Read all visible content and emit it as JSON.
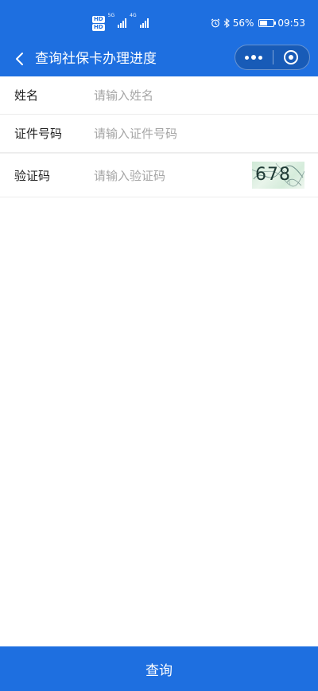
{
  "status_bar": {
    "hd_top": "HD",
    "hd_bottom": "HD",
    "network_1": "5G",
    "network_2": "4G",
    "battery_percent": "56%",
    "battery_level": 0.56,
    "time": "09:53",
    "icons": [
      "alarm-icon",
      "bluetooth-icon",
      "battery-icon"
    ]
  },
  "nav": {
    "title": "查询社保卡办理进度",
    "back_icon": "chevron-left-icon",
    "more_icon": "more-dots-icon",
    "close_icon": "target-circle-icon"
  },
  "form": {
    "name": {
      "label": "姓名",
      "placeholder": "请输入姓名",
      "value": ""
    },
    "id_number": {
      "label": "证件号码",
      "placeholder": "请输入证件号码",
      "value": ""
    },
    "captcha": {
      "label": "验证码",
      "placeholder": "请输入验证码",
      "value": "",
      "image_text": "678"
    }
  },
  "submit": {
    "label": "查询"
  },
  "colors": {
    "primary": "#1e6fe0",
    "placeholder": "#a6a6a6",
    "text": "#222222"
  }
}
